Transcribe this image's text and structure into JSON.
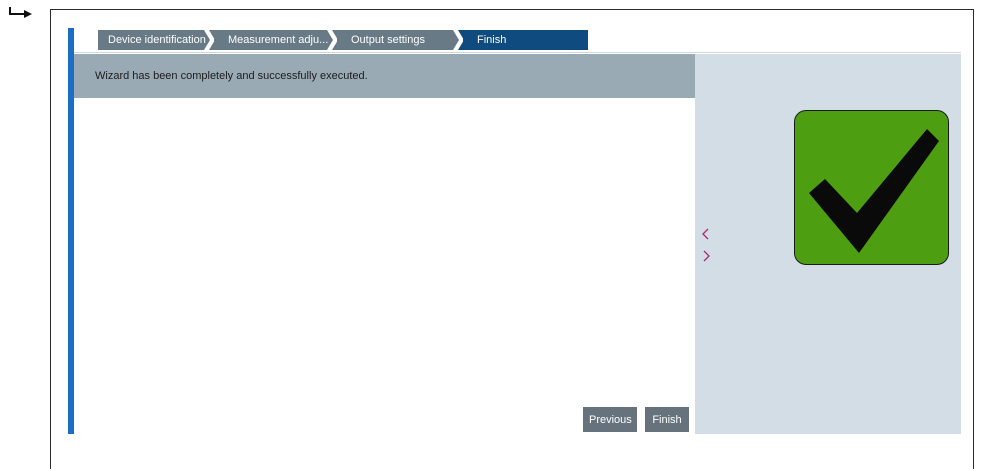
{
  "icons": {
    "result": "result-arrow-icon",
    "prev": "chevron-left-icon",
    "next": "chevron-right-icon",
    "success": "checkmark-icon"
  },
  "colors": {
    "accent": "#1a6fc4",
    "crumb": "#677a86",
    "crumb_active": "#0f4b7f",
    "banner": "#9aaab4",
    "side_panel": "#d3dde6",
    "success": "#4e9e12",
    "button": "#66737c"
  },
  "wizard": {
    "steps": [
      {
        "label": "Device identification"
      },
      {
        "label": "Measurement adju..."
      },
      {
        "label": "Output settings"
      },
      {
        "label": "Finish",
        "active": true
      }
    ],
    "status_message": "Wizard has been completely and successfully executed.",
    "buttons": {
      "previous": "Previous",
      "finish": "Finish"
    }
  }
}
